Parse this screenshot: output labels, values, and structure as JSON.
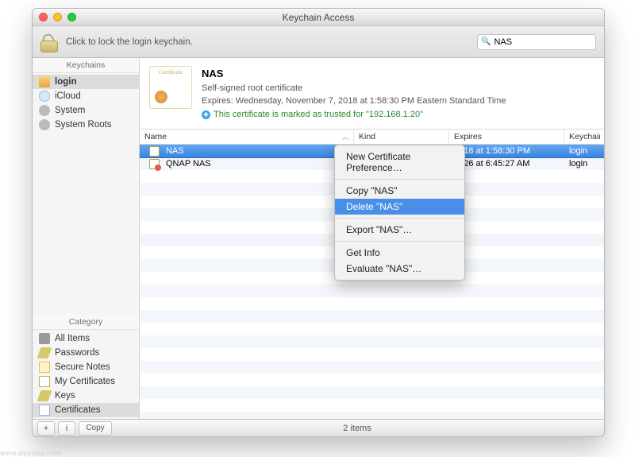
{
  "window": {
    "title": "Keychain Access"
  },
  "toolbar": {
    "lock_text": "Click to lock the login keychain.",
    "search_value": "NAS"
  },
  "sidebar": {
    "top_header": "Keychains",
    "top_items": [
      {
        "label": "login",
        "icon": "ic-folder",
        "selected": true
      },
      {
        "label": "iCloud",
        "icon": "ic-cloud",
        "selected": false
      },
      {
        "label": "System",
        "icon": "ic-gear",
        "selected": false
      },
      {
        "label": "System Roots",
        "icon": "ic-gear",
        "selected": false
      }
    ],
    "bottom_header": "Category",
    "bottom_items": [
      {
        "label": "All Items",
        "icon": "ic-allkey",
        "selected": false
      },
      {
        "label": "Passwords",
        "icon": "ic-key",
        "selected": false
      },
      {
        "label": "Secure Notes",
        "icon": "ic-note",
        "selected": false
      },
      {
        "label": "My Certificates",
        "icon": "ic-cert",
        "selected": false
      },
      {
        "label": "Keys",
        "icon": "ic-key",
        "selected": false
      },
      {
        "label": "Certificates",
        "icon": "ic-certs",
        "selected": true
      }
    ]
  },
  "detail": {
    "name": "NAS",
    "kind": "Self-signed root certificate",
    "expires": "Expires: Wednesday, November 7, 2018 at 1:58:30 PM Eastern Standard Time",
    "trust": "This certificate is marked as trusted for \"192.168.1.20\""
  },
  "columns": {
    "name": "Name",
    "kind": "Kind",
    "expires": "Expires",
    "keychain": "Keychain"
  },
  "rows": [
    {
      "name": "NAS",
      "kind": "",
      "expires": "2018 at 1:58:30 PM",
      "keychain": "login",
      "selected": true,
      "bad": false
    },
    {
      "name": "QNAP NAS",
      "kind": "",
      "expires": "2026 at 6:45:27 AM",
      "keychain": "login",
      "selected": false,
      "bad": true
    }
  ],
  "context_menu": {
    "items": [
      {
        "label": "New Certificate Preference…",
        "hl": false
      },
      {
        "sep": true
      },
      {
        "label": "Copy \"NAS\"",
        "hl": false
      },
      {
        "label": "Delete \"NAS\"",
        "hl": true
      },
      {
        "sep": true
      },
      {
        "label": "Export \"NAS\"…",
        "hl": false
      },
      {
        "sep": true
      },
      {
        "label": "Get Info",
        "hl": false
      },
      {
        "label": "Evaluate \"NAS\"…",
        "hl": false
      }
    ]
  },
  "status": {
    "add": "+",
    "info": "i",
    "copy": "Copy",
    "count": "2 items"
  }
}
